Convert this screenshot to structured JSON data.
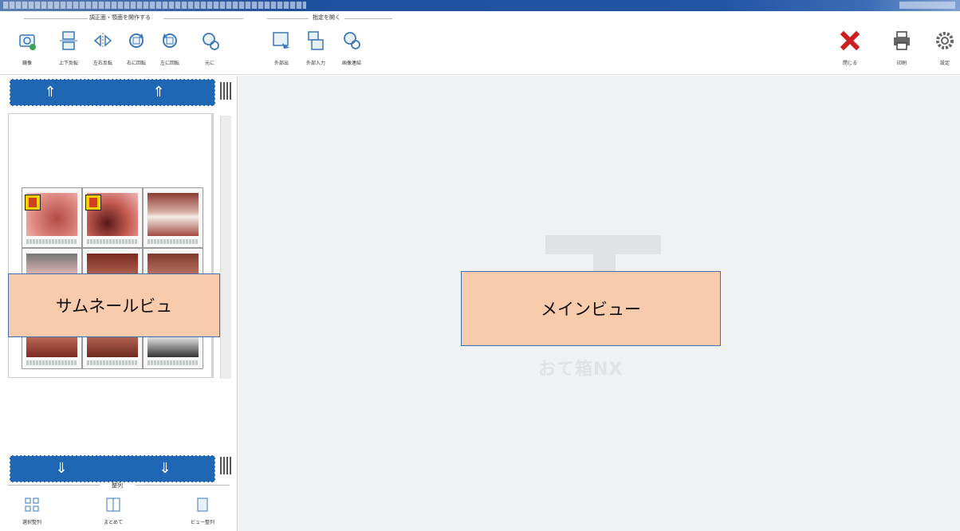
{
  "ribbon": {
    "group1_label": "調正面・顎面を開作する",
    "group2_label": "指定を開く",
    "buttons1": [
      "鏡像",
      "上下反転",
      "左右反転",
      "右に回転",
      "左に回転",
      "元に"
    ],
    "buttons2": [
      "外部出",
      "外部入力",
      "画像連結"
    ],
    "close_label": "閉じる",
    "print_label": "印刷",
    "settings_label": "設定"
  },
  "bottom_group": {
    "label": "整列",
    "buttons": [
      "選択整列",
      "まとめて",
      "ビュー整列"
    ]
  },
  "mainview": {
    "logo_text": "おて箱NX"
  },
  "callouts": {
    "thumbnail": "サムネールビュ",
    "main": "メインビュー"
  },
  "colors": {
    "accent": "#1f66b5",
    "callout_fill": "#f8cbad",
    "callout_border": "#3f6fae",
    "close_red": "#cc1f1f"
  },
  "icons": [
    "camera-mirror-icon",
    "flip-vertical-icon",
    "flip-horizontal-icon",
    "rotate-right-icon",
    "rotate-left-icon",
    "reset-icon",
    "export-icon",
    "import-icon",
    "link-images-icon",
    "close-icon",
    "printer-icon",
    "gear-icon"
  ]
}
